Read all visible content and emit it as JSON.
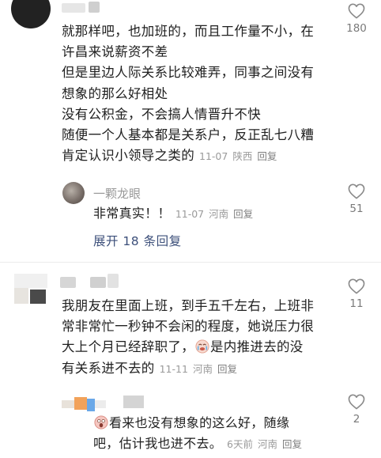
{
  "comments": [
    {
      "lines": [
        "就那样吧，也加班的，而且工作量不小，在",
        "许昌来说薪资不差",
        "但是里边人际关系比较难弄，同事之间没有",
        "想象的那么好相处",
        "没有公积金，不会搞人情晋升不快",
        "随便一个人基本都是关系户，反正乱七八糟",
        "肯定认识小领导之类的"
      ],
      "date": "11-07",
      "location": "陕西",
      "reply_label": "回复",
      "likes": "180"
    },
    {
      "lines": [
        "我朋友在里面上班，到手五千左右，上班非",
        "常非常忙一秒钟不会闲的程度，她说压力很",
        "大上个月已经辞职了，",
        "有关系进不去的"
      ],
      "line3_tail": "是内推进去的没",
      "date": "11-11",
      "location": "河南",
      "reply_label": "回复",
      "likes": "11"
    }
  ],
  "replies": [
    {
      "author": "一颗龙眼",
      "text": "非常真实！！",
      "date": "11-07",
      "location": "河南",
      "reply_label": "回复",
      "likes": "51"
    },
    {
      "line1_tail": "看来也没有想象的这么好，随缘",
      "line2": "吧，估计我也进不去。",
      "date": "6天前",
      "location": "河南",
      "reply_label": "回复",
      "likes": "2"
    }
  ],
  "expand_label": "展开 18 条回复",
  "colors": {
    "link": "#3c4f7a",
    "meta": "#9a9a9a",
    "text": "#202020"
  },
  "icons": {
    "like": "heart-outline-icon",
    "emoji_1": "crying-face-emoji-icon",
    "emoji_2": "scared-face-emoji-icon"
  }
}
